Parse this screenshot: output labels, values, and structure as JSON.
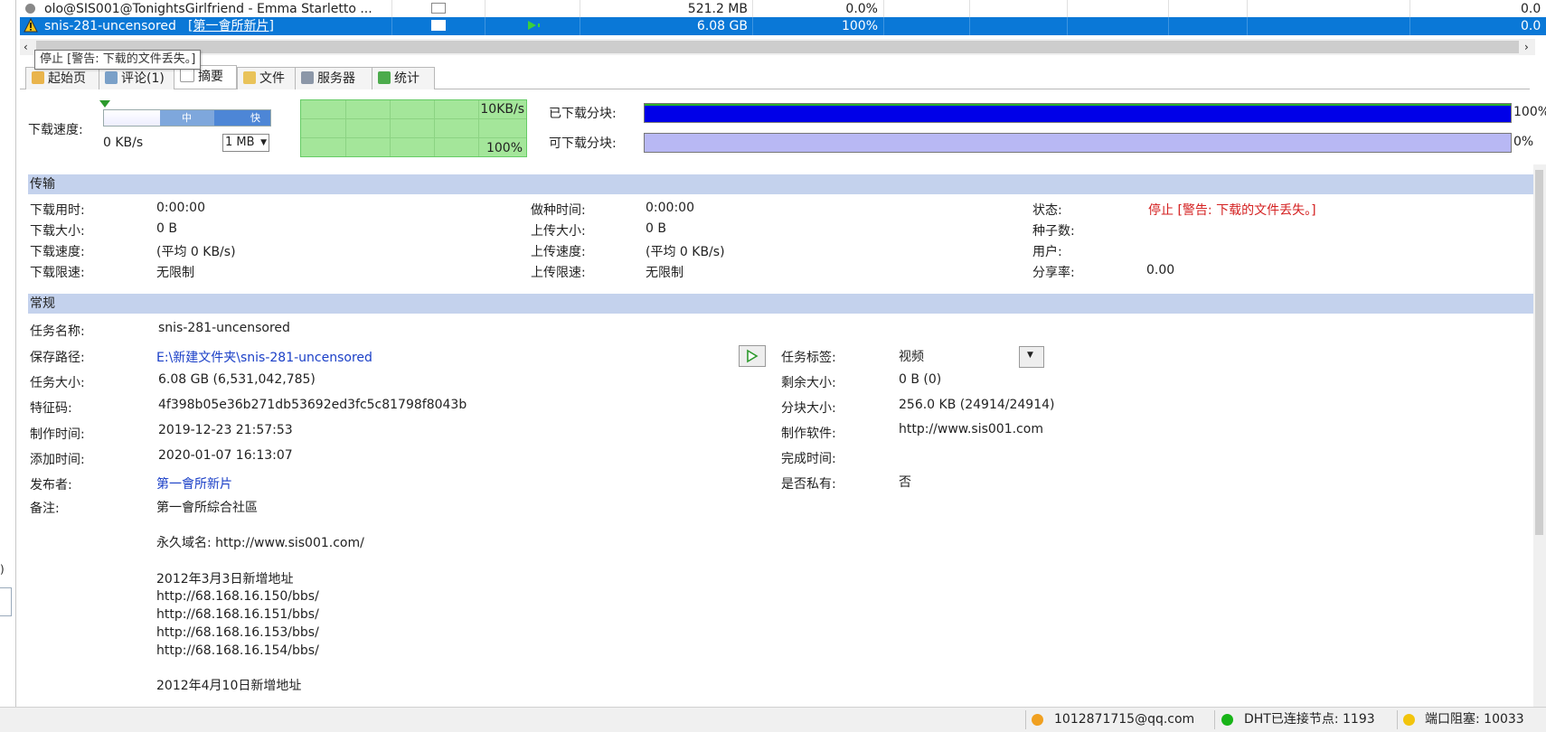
{
  "task_list": {
    "rows": [
      {
        "name": "olo@SIS001@TonightsGirlfriend - Emma Starletto ...",
        "size": "521.2 MB",
        "progress": "0.0%",
        "last": "0.0"
      },
      {
        "name": "snis-281-uncensored",
        "link_text": "[第一會所新片]",
        "size": "6.08 GB",
        "progress": "100%",
        "last": "0.0"
      }
    ]
  },
  "tooltip": "停止 [警告: 下载的文件丢失。]",
  "tabs": [
    "起始页",
    "评论(1)",
    "摘要",
    "文件",
    "服务器",
    "统计"
  ],
  "speed": {
    "label": "下载速度:",
    "value": "0 KB/s",
    "slider_mid": "中",
    "slider_fast": "快",
    "size_select": "1 MB",
    "graph_top": "10KB/s",
    "graph_bottom": "100%"
  },
  "blocks": {
    "downloaded_label": "已下载分块:",
    "downloaded_pct": "100%",
    "downloaded_fraction": 1.0,
    "available_label": "可下载分块:",
    "available_pct": "0%",
    "available_fraction": 1.0
  },
  "transfer": {
    "header": "传输",
    "download_time_label": "下载用时:",
    "download_time": "0:00:00",
    "download_size_label": "下载大小:",
    "download_size": "0 B",
    "download_speed_label": "下载速度:",
    "download_speed": "(平均 0 KB/s)",
    "download_limit_label": "下载限速:",
    "download_limit": "无限制",
    "seed_time_label": "做种时间:",
    "seed_time": "0:00:00",
    "upload_size_label": "上传大小:",
    "upload_size": "0 B",
    "upload_speed_label": "上传速度:",
    "upload_speed": "(平均 0 KB/s)",
    "upload_limit_label": "上传限速:",
    "upload_limit": "无限制",
    "status_label": "状态:",
    "status": "停止 [警告: 下载的文件丢失。]",
    "seeds_label": "种子数:",
    "users_label": "用户:",
    "share_ratio_label": "分享率:",
    "share_ratio": "0.00"
  },
  "general": {
    "header": "常规",
    "task_name_label": "任务名称:",
    "task_name": "snis-281-uncensored",
    "save_path_label": "保存路径:",
    "save_path": "E:\\新建文件夹\\snis-281-uncensored",
    "task_size_label": "任务大小:",
    "task_size": "6.08 GB (6,531,042,785)",
    "hash_label": "特征码:",
    "hash": "4f398b05e36b271db53692ed3fc5c81798f8043b",
    "created_label": "制作时间:",
    "created": "2019-12-23 21:57:53",
    "added_label": "添加时间:",
    "added": "2020-01-07 16:13:07",
    "publisher_label": "发布者:",
    "publisher": "第一會所新片",
    "notes_label": "备注:",
    "notes": [
      "第一會所綜合社區",
      "",
      "永久域名: http://www.sis001.com/",
      "",
      "2012年3月3日新增地址",
      "http://68.168.16.150/bbs/",
      "http://68.168.16.151/bbs/",
      "http://68.168.16.153/bbs/",
      "http://68.168.16.154/bbs/",
      "",
      "2012年4月10日新增地址"
    ],
    "tag_label": "任务标签:",
    "tag": "视频",
    "remaining_label": "剩余大小:",
    "remaining": "0 B (0)",
    "piece_size_label": "分块大小:",
    "piece_size": "256.0 KB (24914/24914)",
    "software_label": "制作软件:",
    "software": "http://www.sis001.com",
    "completed_label": "完成时间:",
    "private_label": "是否私有:",
    "private": "否"
  },
  "statusbar": {
    "email": "1012871715@qq.com",
    "dht": "DHT已连接节点: 1193",
    "port": "端口阻塞: 10033"
  },
  "colors": {
    "selection": "#0a78d7",
    "downloaded_bar": "#0000e8",
    "available_bar": "#b8b8f4",
    "section_header": "#c4d2ed",
    "status_red": "#d42020",
    "graph_green": "#a4e69a"
  }
}
